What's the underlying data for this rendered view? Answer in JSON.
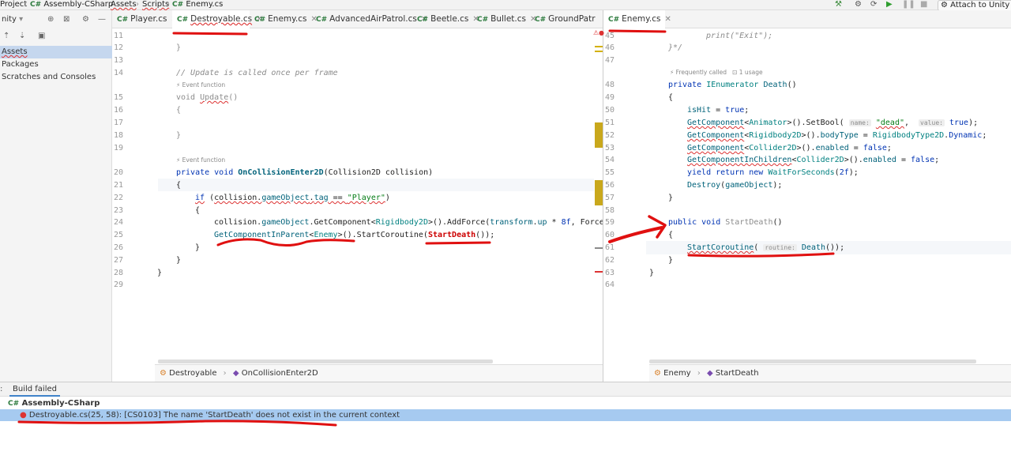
{
  "topbar": {
    "crumbs": [
      "Project",
      "Assembly-CSharp",
      "Assets",
      "Scripts",
      "Enemy.cs"
    ],
    "attach_label": "Attach to Unity Ed"
  },
  "sidebar": {
    "title": "nity",
    "items": [
      "Assets",
      "Packages",
      "Scratches and Consoles"
    ]
  },
  "left_tabs": [
    "Player.cs",
    "Destroyable.cs",
    "Enemy.cs",
    "AdvancedAirPatrol.cs",
    "Beetle.cs",
    "Bullet.cs",
    "GroundPatr"
  ],
  "right_tabs": [
    "Enemy.cs"
  ],
  "left_editor": {
    "lines": [
      "11",
      "12",
      "13",
      "14",
      "15",
      "16",
      "17",
      "18",
      "19",
      "20",
      "21",
      "22",
      "23",
      "24",
      "25",
      "26",
      "27",
      "28",
      "29"
    ],
    "hint_event1": "Event function",
    "hint_event2": "Event function",
    "breadcrumb_class": "Destroyable",
    "breadcrumb_method": "OnCollisionEnter2D"
  },
  "right_editor": {
    "lines": [
      "45",
      "46",
      "47",
      "48",
      "49",
      "50",
      "51",
      "52",
      "53",
      "54",
      "55",
      "56",
      "57",
      "58",
      "59",
      "60",
      "61",
      "62",
      "63",
      "64"
    ],
    "hint_called": "Frequently called",
    "hint_usage": "1 usage",
    "breadcrumb_class": "Enemy",
    "breadcrumb_method": "StartDeath"
  },
  "bottom": {
    "tab_label": "Build failed",
    "project": "Assembly-CSharp",
    "error": "Destroyable.cs(25, 58): [CS0103] The name 'StartDeath' does not exist in the current context"
  },
  "colors": {
    "selection": "#c5d7ee",
    "error_row": "#a6caf0",
    "annotation_red": "#e01010"
  }
}
